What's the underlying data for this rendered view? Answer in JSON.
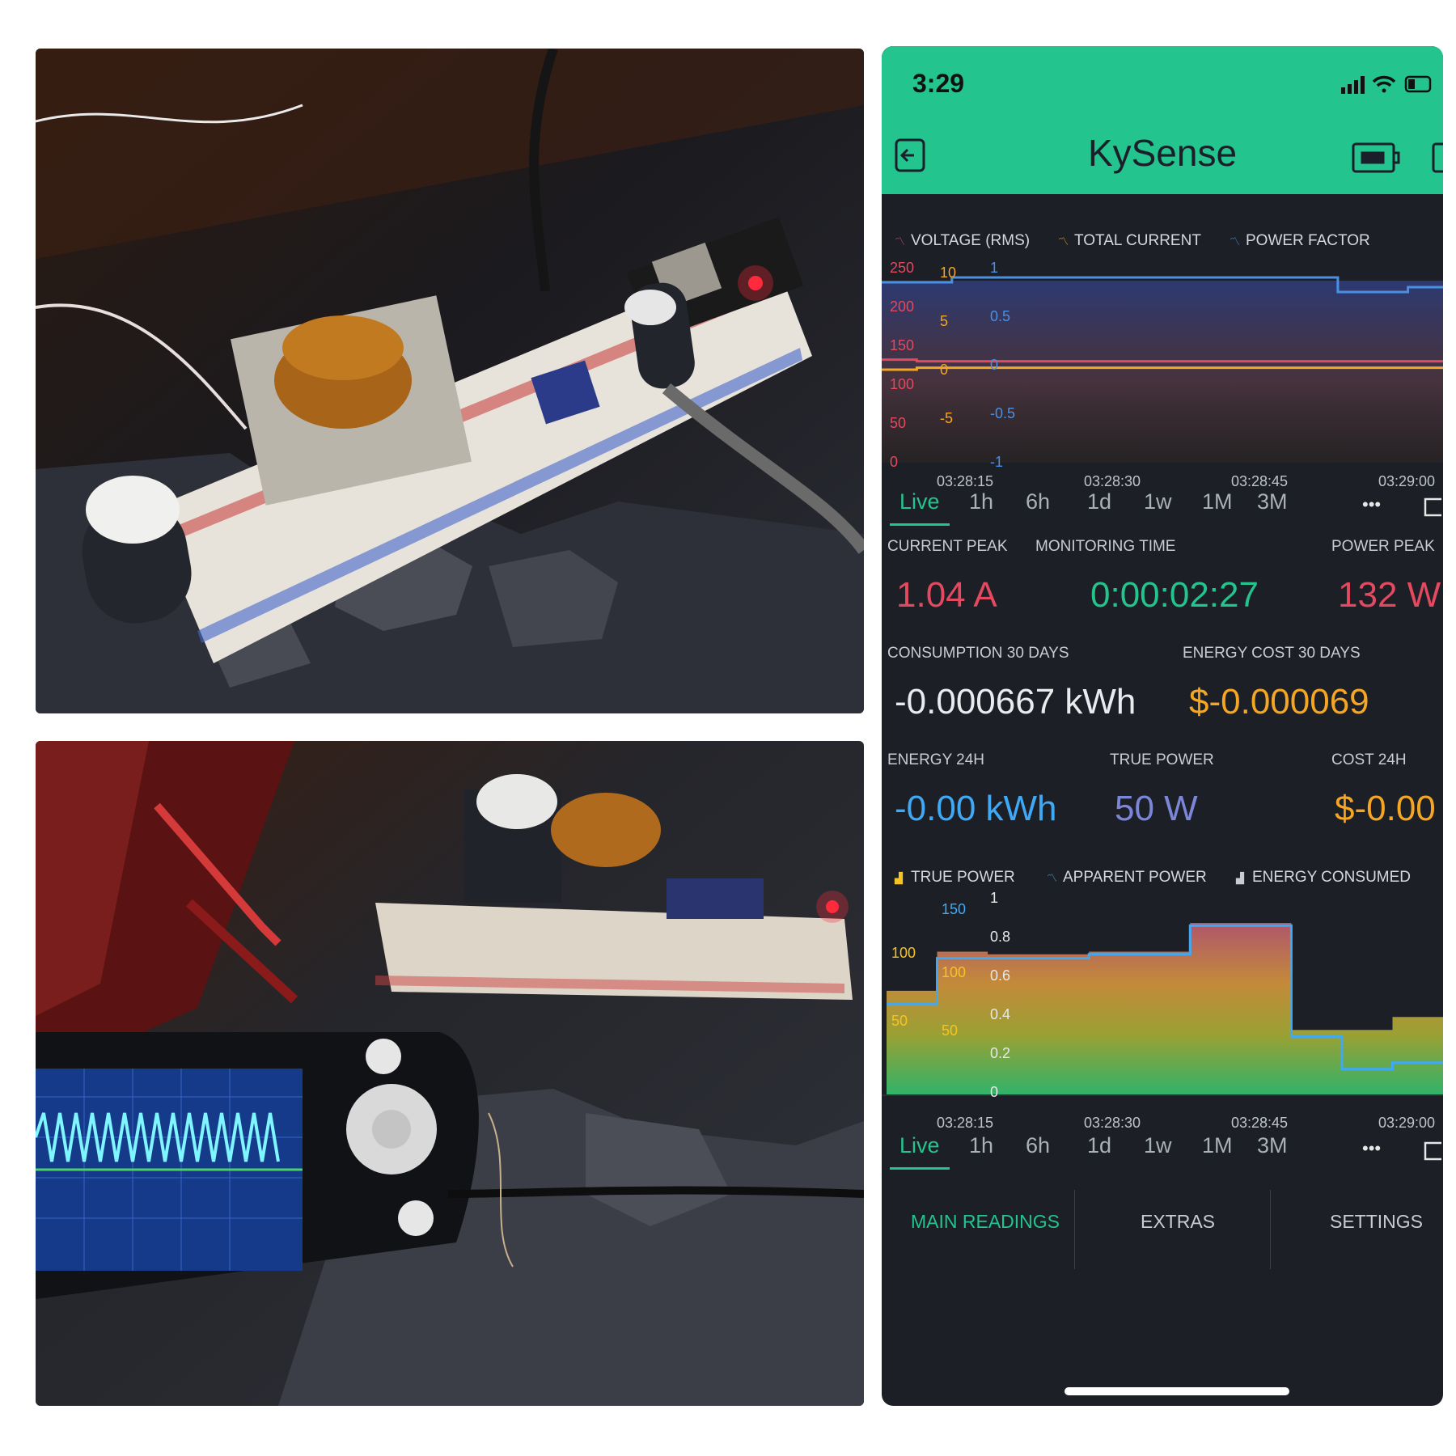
{
  "status_bar": {
    "time": "3:29"
  },
  "app": {
    "title": "KySense"
  },
  "chart1": {
    "legend": [
      "VOLTAGE (RMS)",
      "TOTAL CURRENT",
      "POWER FACTOR"
    ],
    "voltage_ticks": [
      "250",
      "200",
      "150",
      "100",
      "50",
      "0"
    ],
    "current_ticks": [
      "10",
      "5",
      "0",
      "-5"
    ],
    "pf_ticks": [
      "1",
      "0.5",
      "0",
      "-0.5",
      "-1"
    ],
    "time_ticks": [
      "03:28:15",
      "03:28:30",
      "03:28:45",
      "03:29:00"
    ]
  },
  "chart2": {
    "legend": [
      "TRUE POWER",
      "APPARENT POWER",
      "ENERGY CONSUMED"
    ],
    "left_ticks": [
      "150",
      "100",
      "50"
    ],
    "left2_ticks": [
      "100",
      "50"
    ],
    "right_ticks": [
      "1",
      "0.8",
      "0.6",
      "0.4",
      "0.2",
      "0"
    ],
    "time_ticks": [
      "03:28:15",
      "03:28:30",
      "03:28:45",
      "03:29:00"
    ]
  },
  "tabs": [
    "Live",
    "1h",
    "6h",
    "1d",
    "1w",
    "1M",
    "3M"
  ],
  "more_label": "•••",
  "readings": {
    "current_peak_label": "CURRENT PEAK",
    "current_peak": "1.04 A",
    "monitoring_time_label": "MONITORING TIME",
    "monitoring_time": "0:00:02:27",
    "power_peak_label": "POWER PEAK",
    "power_peak": "132 W",
    "consumption_label": "CONSUMPTION 30 DAYS",
    "consumption": "-0.000667 kWh",
    "energy_cost_label": "ENERGY COST 30 DAYS",
    "energy_cost": "$-0.000069",
    "energy24_label": "ENERGY 24H",
    "energy24": "-0.00 kWh",
    "true_power_label": "TRUE POWER",
    "true_power": "50 W",
    "cost24_label": "COST 24H",
    "cost24": "$-0.00"
  },
  "nav": [
    "MAIN READINGS",
    "EXTRAS",
    "SETTINGS"
  ],
  "colors": {
    "accent": "#23c48e",
    "red": "#e3495f",
    "orange": "#f5a623",
    "blue": "#4a90e2",
    "lavender": "#7b86d8",
    "panel": "#1c1f26"
  },
  "chart_data": [
    {
      "type": "line",
      "series": [
        {
          "name": "VOLTAGE (RMS)",
          "values": [
            130,
            128,
            128,
            128,
            128,
            128,
            128,
            128,
            128,
            128,
            128,
            128,
            128,
            128,
            128,
            128
          ]
        },
        {
          "name": "TOTAL CURRENT",
          "values": [
            0,
            0.2,
            0.2,
            0.2,
            0.2,
            0.2,
            0.2,
            0.2,
            0.2,
            0.2,
            0.2,
            0.2,
            0.2,
            0.2,
            0.2,
            0.2
          ]
        },
        {
          "name": "POWER FACTOR",
          "values": [
            0.9,
            0.9,
            0.95,
            0.95,
            0.95,
            0.95,
            0.95,
            0.95,
            0.95,
            0.95,
            0.95,
            0.95,
            0.95,
            0.8,
            0.8,
            0.85
          ]
        }
      ],
      "x": [
        "03:28:15",
        "03:28:30",
        "03:28:45",
        "03:29:00"
      ],
      "ylim": [
        0,
        250
      ]
    },
    {
      "type": "area",
      "series": [
        {
          "name": "TRUE POWER",
          "values": [
            80,
            110,
            108,
            108,
            110,
            110,
            132,
            132,
            50,
            50,
            60
          ]
        },
        {
          "name": "APPARENT POWER",
          "values": [
            70,
            105,
            105,
            105,
            108,
            108,
            130,
            130,
            45,
            20,
            25
          ]
        }
      ],
      "x": [
        "03:28:15",
        "03:28:30",
        "03:28:45",
        "03:29:00"
      ],
      "ylim": [
        0,
        150
      ]
    }
  ]
}
